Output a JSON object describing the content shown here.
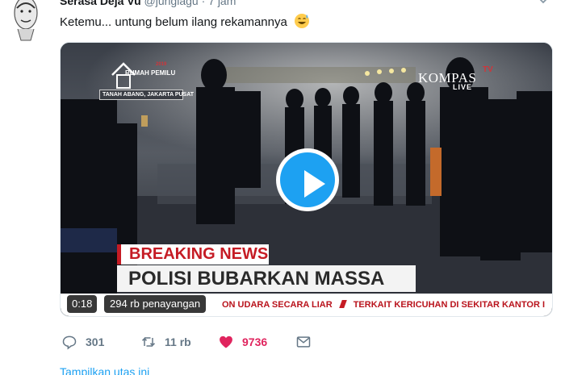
{
  "tweet": {
    "author_name": "Serasa Deja Vu",
    "author_handle": "@jurigiagu",
    "separator": "·",
    "time": "7 jam",
    "text": "Ketemu... untung belum ilang rekamannya",
    "emoji": "grinning-sweat-emoji"
  },
  "video": {
    "channel_logo": "KOMPAS",
    "channel_logo_suffix": "TV",
    "live_label": "LIVE",
    "program_logo": "RUMAH PEMILU",
    "program_year": "2019",
    "location": "TANAH ABANG, JAKARTA PUSAT",
    "breaking_label": "BREAKING NEWS",
    "headline": "POLISI BUBARKAN MASSA",
    "ticker_text_1": "ON UDARA SECARA LIAR",
    "ticker_text_2": "TERKAIT KERICUHAN DI SEKITAR KANTOR I",
    "duration": "0:18",
    "views": "294 rb penayangan",
    "play_icon": "play-icon"
  },
  "actions": {
    "reply_count": "301",
    "retweet_count": "11 rb",
    "like_count": "9736",
    "reply_icon": "reply-icon",
    "retweet_icon": "retweet-icon",
    "like_icon": "heart-icon",
    "dm_icon": "envelope-icon",
    "like_color": "#e0245e"
  },
  "thread_link": "Tampilkan utas ini"
}
